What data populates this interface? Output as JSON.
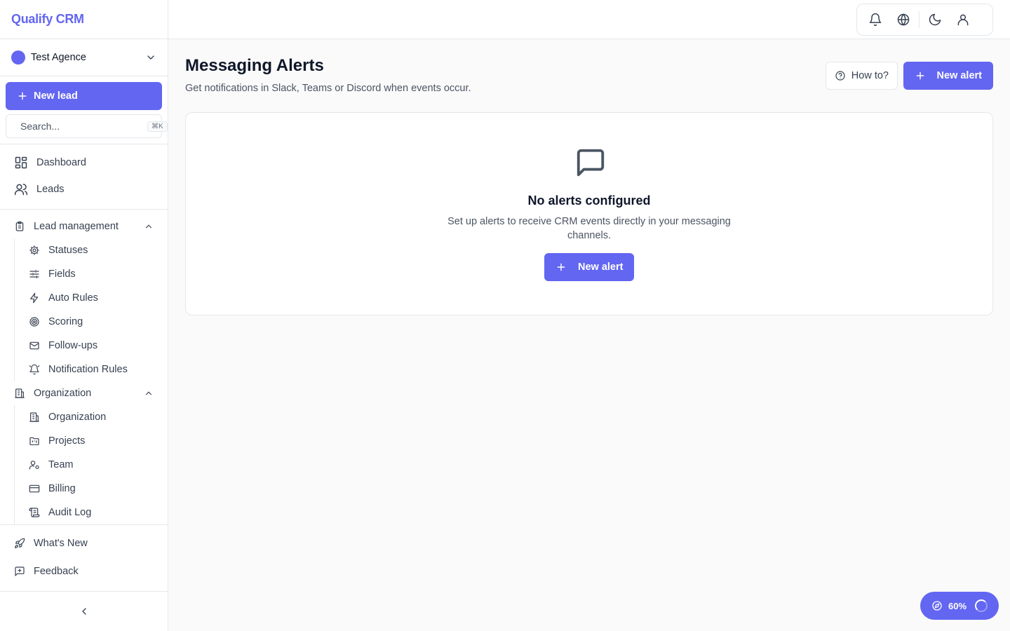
{
  "brand": "Qualify CRM",
  "workspace": {
    "name": "Test Agence",
    "dot_color": "#6366f1"
  },
  "sidebar": {
    "new_lead": "New lead",
    "search_placeholder": "Search...",
    "search_shortcut": "⌘K",
    "primary": [
      {
        "label": "Dashboard",
        "icon": "layout-grid-icon"
      },
      {
        "label": "Leads",
        "icon": "users-icon"
      }
    ],
    "groups": [
      {
        "label": "Lead management",
        "icon": "clipboard-icon",
        "expanded": true,
        "items": [
          {
            "label": "Statuses",
            "icon": "cog-icon"
          },
          {
            "label": "Fields",
            "icon": "sliders-icon"
          },
          {
            "label": "Auto Rules",
            "icon": "zap-icon"
          },
          {
            "label": "Scoring",
            "icon": "target-icon"
          },
          {
            "label": "Follow-ups",
            "icon": "mail-icon"
          },
          {
            "label": "Notification Rules",
            "icon": "bell-ring-icon"
          }
        ]
      },
      {
        "label": "Organization",
        "icon": "building-icon",
        "expanded": true,
        "items": [
          {
            "label": "Organization",
            "icon": "building-icon"
          },
          {
            "label": "Projects",
            "icon": "folder-kanban-icon"
          },
          {
            "label": "Team",
            "icon": "user-cog-icon"
          },
          {
            "label": "Billing",
            "icon": "credit-card-icon"
          },
          {
            "label": "Audit Log",
            "icon": "scroll-icon"
          }
        ]
      }
    ],
    "footer": [
      {
        "label": "What's New",
        "icon": "rocket-icon"
      },
      {
        "label": "Feedback",
        "icon": "message-square-plus-icon"
      }
    ]
  },
  "topbar": {
    "icons": [
      "bell-icon",
      "globe-icon",
      "moon-icon",
      "user-icon"
    ]
  },
  "page": {
    "title": "Messaging Alerts",
    "subtitle": "Get notifications in Slack, Teams or Discord when events occur.",
    "how_to": "How to?",
    "new_alert": "New alert"
  },
  "empty_state": {
    "title": "No alerts configured",
    "description": "Set up alerts to receive CRM events directly in your messaging channels.",
    "button": "New alert"
  },
  "progress_widget": {
    "label": "60%",
    "value": 60
  },
  "colors": {
    "accent": "#6366f1",
    "border": "#e5e7eb",
    "text_muted": "#4b5563"
  }
}
